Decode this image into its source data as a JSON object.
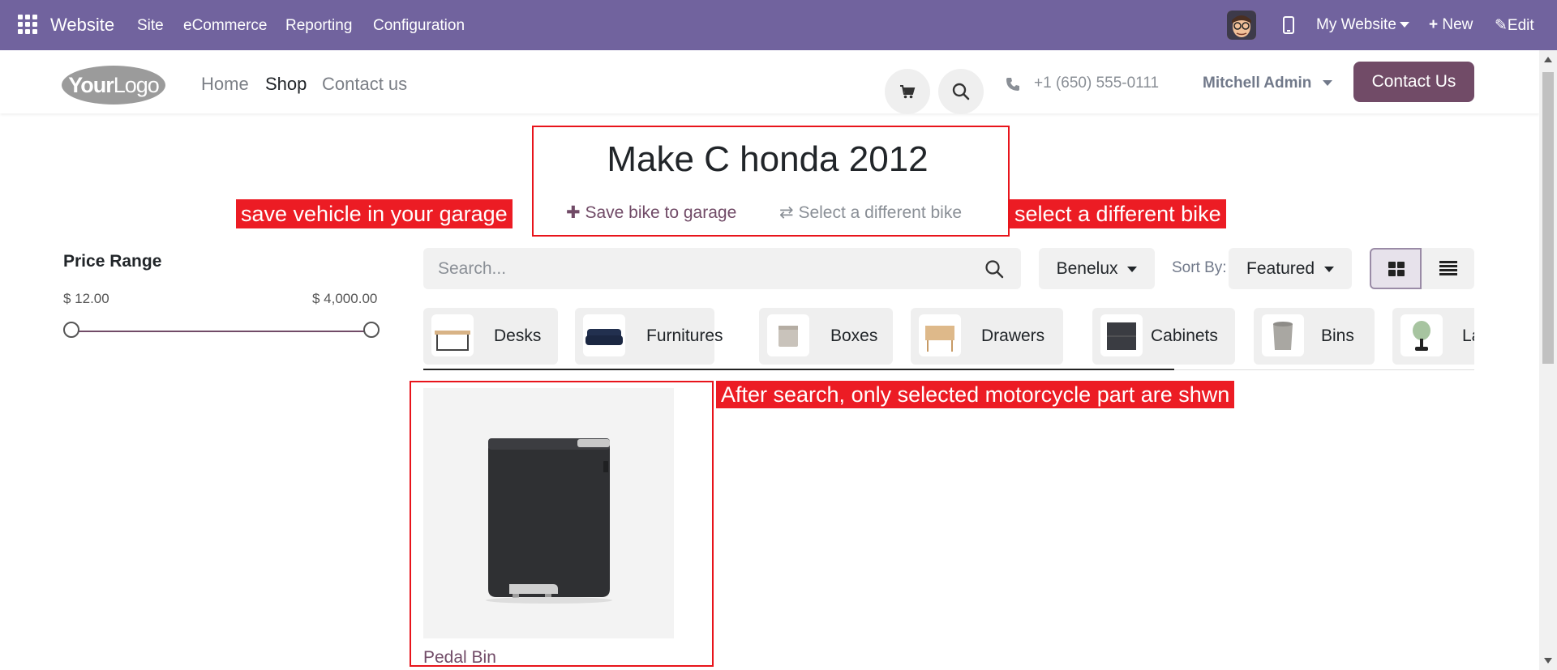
{
  "admin_bar": {
    "app_name": "Website",
    "menu": [
      "Site",
      "eCommerce",
      "Reporting",
      "Configuration"
    ],
    "website_selector": "My Website",
    "new_label": "New",
    "edit_label": "Edit",
    "background": "#71639e"
  },
  "header": {
    "logo_text_bold": "Your",
    "logo_text_light": "Logo",
    "nav": [
      "Home",
      "Shop",
      "Contact us"
    ],
    "active_nav": "Shop",
    "phone": "+1 (650) 555-0111",
    "user": "Mitchell Admin",
    "contact_button": "Contact Us",
    "brand_color": "#714b67"
  },
  "vehicle": {
    "title": "Make C honda 2012",
    "save_label": "Save bike to garage",
    "select_label": "Select a different bike"
  },
  "annotations": {
    "save": "save vehicle in your garage",
    "select": "select a different bike",
    "search_result": "After search, only selected motorcycle part are shwn"
  },
  "filters": {
    "price_title": "Price Range",
    "price_min": "$ 12.00",
    "price_max": "$ 4,000.00"
  },
  "toolbar": {
    "search_placeholder": "Search...",
    "pricelist": "Benelux",
    "sort_label": "Sort By:",
    "sort_value": "Featured"
  },
  "categories": [
    "Desks",
    "Furnitures",
    "Boxes",
    "Drawers",
    "Cabinets",
    "Bins",
    "La"
  ],
  "products": [
    {
      "name": "Pedal Bin"
    }
  ]
}
